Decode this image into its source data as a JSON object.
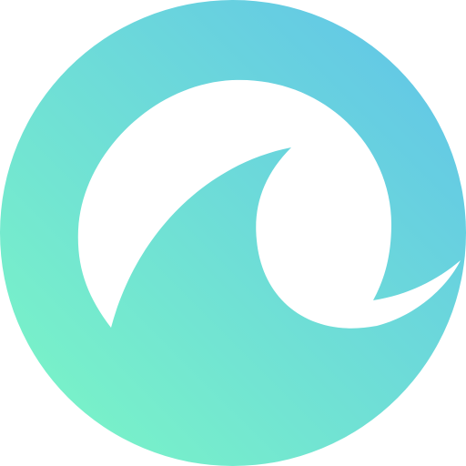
{
  "logo": {
    "icon": "wave-logo-icon",
    "colors": {
      "gradient_start": "#7cf8c4",
      "gradient_end": "#60c2ea",
      "cutout": "#ffffff"
    }
  }
}
